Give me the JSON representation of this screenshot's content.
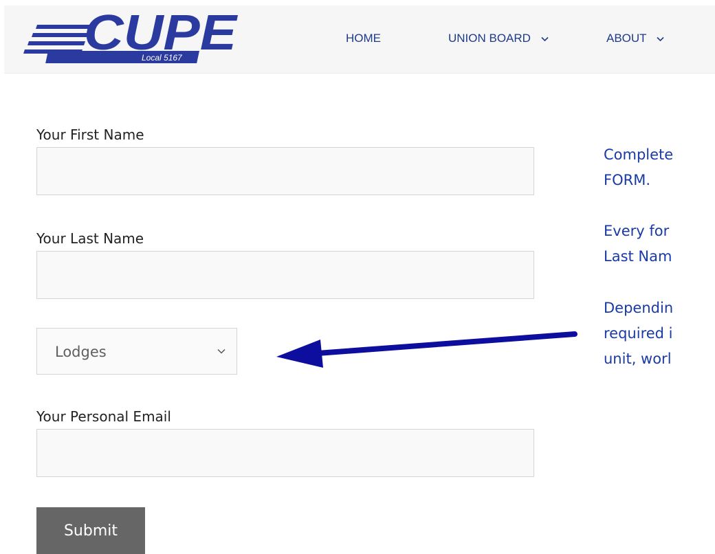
{
  "header": {
    "logo": {
      "brand": "CUPE",
      "local": "Local 5167",
      "colors": {
        "blue": "#2b3a9e",
        "stripe": "#2b3a9e"
      }
    },
    "nav": [
      {
        "label": "HOME",
        "has_dropdown": false
      },
      {
        "label": "UNION BOARD",
        "has_dropdown": true,
        "icon": "chevron-down-icon"
      },
      {
        "label": "ABOUT",
        "has_dropdown": true,
        "icon": "chevron-down-icon"
      }
    ]
  },
  "form": {
    "first_name": {
      "label": "Your First Name",
      "value": ""
    },
    "last_name": {
      "label": "Your Last Name",
      "value": ""
    },
    "unit_select": {
      "selected": "Lodges",
      "icon": "chevron-down-icon"
    },
    "email": {
      "label": "Your Personal Email",
      "value": ""
    },
    "submit_label": "Submit"
  },
  "instructions": {
    "line1": "Complete",
    "line2": "FORM.",
    "line3": "Every for",
    "line4": "Last Nam",
    "line5": "Dependin",
    "line6": "required i",
    "line7": "unit, worl"
  },
  "annotation": {
    "arrow_color": "#0d0d9e",
    "arrow_icon": "arrow-left-icon"
  },
  "colors": {
    "nav_text": "#1e3a8a",
    "instruction_text": "#1a3aa4",
    "submit_bg": "#666666"
  }
}
